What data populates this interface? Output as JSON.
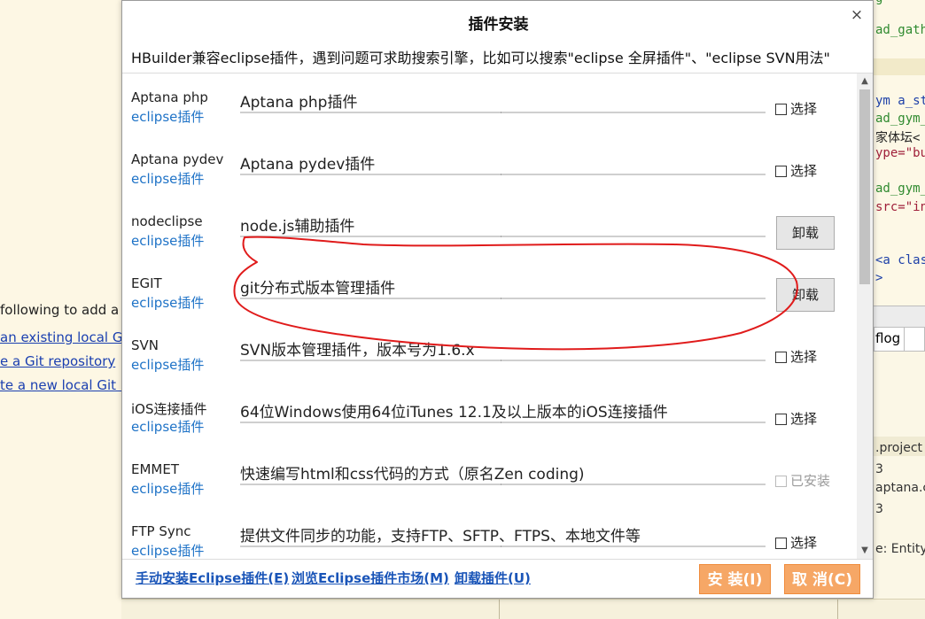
{
  "background": {
    "left_lines": [
      {
        "text": "following to add a r",
        "link": false
      },
      {
        "text": "an existing local Gi",
        "link": true
      },
      {
        "text": "e a Git repository",
        "link": true
      },
      {
        "text": "te a new local Git r",
        "link": true
      }
    ],
    "code_lines": [
      {
        "text": "g",
        "cls": "c-green"
      },
      {
        "text": "ad_gath",
        "cls": "c-green"
      },
      {
        "text": "ym a_st",
        "cls": "c-blue"
      },
      {
        "text": "ad_gym_",
        "cls": "c-green"
      },
      {
        "text": "家体坛<",
        "cls": "c-black"
      },
      {
        "text": "ype=\"bu",
        "cls": "c-red"
      },
      {
        "text": "ad_gym_",
        "cls": "c-green"
      },
      {
        "text": "src=\"in",
        "cls": "c-red"
      },
      {
        "text": "<a clas",
        "cls": "c-blue"
      },
      {
        "text": ">",
        "cls": "c-blue"
      }
    ],
    "tab_label": "flog",
    "right_lines": [
      ".project",
      "3",
      "aptana.c",
      "3",
      "e: Entity."
    ]
  },
  "dialog": {
    "title": "插件安装",
    "close_icon": "×",
    "description": "HBuilder兼容eclipse插件，遇到问题可求助搜索引擎，比如可以搜索\"eclipse 全屏插件\"、\"eclipse SVN用法\"",
    "plugins": [
      {
        "name": "Aptana php",
        "source": "eclipse插件",
        "description": "Aptana php插件",
        "action": "checkbox",
        "label": "选择"
      },
      {
        "name": "Aptana pydev",
        "source": "eclipse插件",
        "description": "Aptana pydev插件",
        "action": "checkbox",
        "label": "选择"
      },
      {
        "name": "nodeclipse",
        "source": "eclipse插件",
        "description": "node.js辅助插件",
        "action": "button",
        "label": "卸载"
      },
      {
        "name": "EGIT",
        "source": "eclipse插件",
        "description": "git分布式版本管理插件",
        "action": "button",
        "label": "卸载"
      },
      {
        "name": "SVN",
        "source": "eclipse插件",
        "description": "SVN版本管理插件，版本号为1.6.x",
        "action": "checkbox",
        "label": "选择"
      },
      {
        "name": "iOS连接插件",
        "source": "eclipse插件",
        "description": "64位Windows使用64位iTunes 12.1及以上版本的iOS连接插件",
        "action": "checkbox",
        "label": "选择"
      },
      {
        "name": "EMMET",
        "source": "eclipse插件",
        "description": "快速编写html和css代码的方式（原名Zen coding)",
        "action": "installed",
        "label": "已安装"
      },
      {
        "name": "FTP Sync",
        "source": "eclipse插件",
        "description": "提供文件同步的功能，支持FTP、SFTP、FTPS、本地文件等",
        "action": "checkbox",
        "label": "选择"
      }
    ],
    "footer": {
      "manual_install": "手动安装Eclipse插件(E)",
      "browse_market": "浏览Eclipse插件市场(M)",
      "uninstall": "卸载插件(U)",
      "install_button": "安 装(I)",
      "cancel_button": "取 消(C)"
    }
  },
  "colors": {
    "accent_orange": "#f6a766",
    "link_blue": "#1f73c7",
    "annotation_red": "#e01b1b"
  }
}
